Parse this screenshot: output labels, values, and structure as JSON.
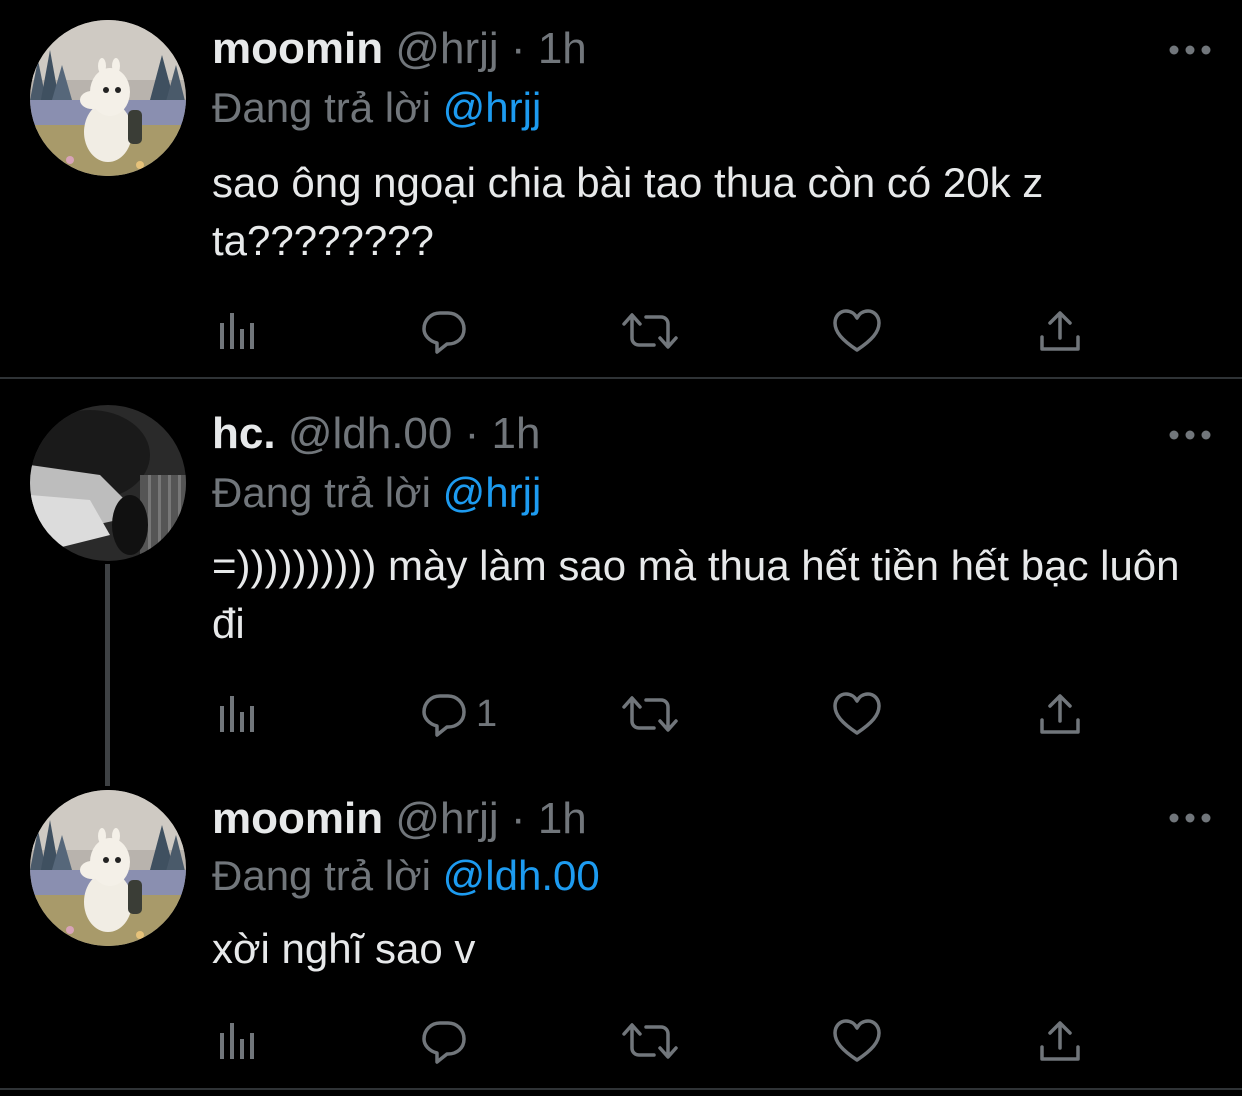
{
  "colors": {
    "background": "#000000",
    "text": "#e7e9ea",
    "muted": "#71767b",
    "mention": "#1d9bf0",
    "divider": "#2f3336"
  },
  "tweets": [
    {
      "name": "moomin",
      "handle": "@hrjj",
      "dot": "·",
      "time": "1h",
      "replying_prefix": "Đang trả lời",
      "replying_to": "@hrjj",
      "text": "sao ông ngoại chia bài tao thua còn có 20k z ta????????",
      "reply_count": "",
      "avatar_icon": "moomin-avatar"
    },
    {
      "name": "hc.",
      "handle": "@ldh.00",
      "dot": "·",
      "time": "1h",
      "replying_prefix": "Đang trả lời",
      "replying_to": "@hrjj",
      "text": "=)))))))))) mày làm sao mà thua hết tiền hết bạc luôn đi",
      "reply_count": "1",
      "avatar_icon": "dark-photo-avatar"
    },
    {
      "name": "moomin",
      "handle": "@hrjj",
      "dot": "·",
      "time": "1h",
      "replying_prefix": "Đang trả lời",
      "replying_to": "@ldh.00",
      "text": "xời nghĩ sao v",
      "reply_count": "",
      "avatar_icon": "moomin-avatar"
    }
  ],
  "action_icons": [
    "analytics-icon",
    "reply-icon",
    "retweet-icon",
    "like-icon",
    "share-icon"
  ]
}
